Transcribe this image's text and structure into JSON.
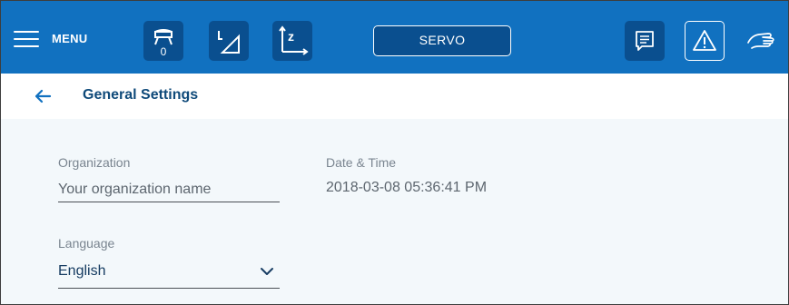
{
  "topbar": {
    "menu_label": "MENU",
    "tool_count": "0",
    "servo_label": "SERVO",
    "background": "#1171c0",
    "button_background": "#0a4f8f",
    "icons": [
      "hamburger-icon",
      "tool-frame-icon",
      "user-frame-icon",
      "coordinate-jog-icon",
      "message-icon",
      "warning-icon",
      "hand-icon"
    ]
  },
  "header": {
    "title": "General Settings",
    "back_icon": "back-arrow-icon"
  },
  "settings": {
    "organization": {
      "label": "Organization",
      "placeholder": "Your organization name",
      "value": ""
    },
    "datetime": {
      "label": "Date & Time",
      "value": "2018-03-08 05:36:41 PM"
    },
    "language": {
      "label": "Language",
      "value": "English"
    }
  },
  "colors": {
    "title": "#0f4a7a",
    "content_background": "#f3f8fb"
  }
}
